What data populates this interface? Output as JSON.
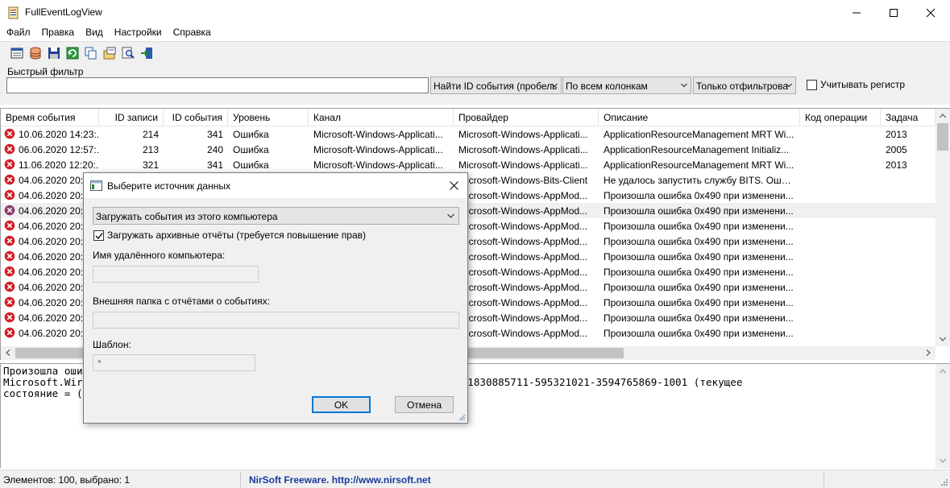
{
  "window": {
    "title": "FullEventLogView",
    "icon": "app-icon",
    "controls": [
      "minimize-icon",
      "maximize-icon",
      "close-icon"
    ]
  },
  "menu": [
    "Файл",
    "Правка",
    "Вид",
    "Настройки",
    "Справка"
  ],
  "toolbar": {
    "icons": [
      "properties-icon",
      "database-icon",
      "save-icon",
      "refresh-icon",
      "copy-icon",
      "export-html-icon",
      "find-icon",
      "exit-icon"
    ]
  },
  "filter": {
    "label": "Быстрый фильтр",
    "value": "",
    "combo1": "Найти ID события (пробель",
    "combo2": "По всем колонкам",
    "combo3": "Только отфильтрова",
    "case_label": "Учитывать регистр",
    "case_checked": false
  },
  "columns": [
    "Время события",
    "ID записи",
    "ID события",
    "Уровень",
    "Канал",
    "Провайдер",
    "Описание",
    "Код операции",
    "Задача"
  ],
  "rows": [
    {
      "time": "10.06.2020 14:23:...",
      "record": "214",
      "event": "341",
      "level": "Ошибка",
      "channel": "Microsoft-Windows-Applicati...",
      "provider": "Microsoft-Windows-Applicati...",
      "desc": "ApplicationResourceManagement MRT Wi...",
      "opcode": "",
      "task": "2013",
      "icon": "error-icon"
    },
    {
      "time": "06.06.2020 12:57:...",
      "record": "213",
      "event": "240",
      "level": "Ошибка",
      "channel": "Microsoft-Windows-Applicati...",
      "provider": "Microsoft-Windows-Applicati...",
      "desc": "ApplicationResourceManagement Initializ...",
      "opcode": "",
      "task": "2005",
      "icon": "error-icon"
    },
    {
      "time": "11.06.2020 12:20:...",
      "record": "321",
      "event": "341",
      "level": "Ошибка",
      "channel": "Microsoft-Windows-Applicati...",
      "provider": "Microsoft-Windows-Applicati...",
      "desc": "ApplicationResourceManagement MRT Wi...",
      "opcode": "",
      "task": "2013",
      "icon": "error-icon"
    },
    {
      "time": "04.06.2020 20:1",
      "record": "",
      "event": "",
      "level": "",
      "channel": "",
      "provider": "Microsoft-Windows-Bits-Client",
      "desc": "Не удалось запустить службу BITS. Ошиб...",
      "opcode": "",
      "task": "",
      "icon": "error-icon"
    },
    {
      "time": "04.06.2020 20:2",
      "record": "",
      "event": "",
      "level": "",
      "channel": "",
      "provider": "Microsoft-Windows-AppMod...",
      "desc": "Произошла ошибка 0x490 при изменени...",
      "opcode": "",
      "task": "",
      "icon": "error-icon"
    },
    {
      "time": "04.06.2020 20:2",
      "record": "",
      "event": "",
      "level": "",
      "channel": "",
      "provider": "Microsoft-Windows-AppMod...",
      "desc": "Произошла ошибка 0x490 при изменени...",
      "opcode": "",
      "task": "",
      "icon": "error-selected-icon",
      "selected": true
    },
    {
      "time": "04.06.2020 20:2",
      "record": "",
      "event": "",
      "level": "",
      "channel": "",
      "provider": "Microsoft-Windows-AppMod...",
      "desc": "Произошла ошибка 0x490 при изменени...",
      "opcode": "",
      "task": "",
      "icon": "error-icon"
    },
    {
      "time": "04.06.2020 20:2",
      "record": "",
      "event": "",
      "level": "",
      "channel": "",
      "provider": "Microsoft-Windows-AppMod...",
      "desc": "Произошла ошибка 0x490 при изменени...",
      "opcode": "",
      "task": "",
      "icon": "error-icon"
    },
    {
      "time": "04.06.2020 20:2",
      "record": "",
      "event": "",
      "level": "",
      "channel": "",
      "provider": "Microsoft-Windows-AppMod...",
      "desc": "Произошла ошибка 0x490 при изменени...",
      "opcode": "",
      "task": "",
      "icon": "error-icon"
    },
    {
      "time": "04.06.2020 20:2",
      "record": "",
      "event": "",
      "level": "",
      "channel": "",
      "provider": "Microsoft-Windows-AppMod...",
      "desc": "Произошла ошибка 0x490 при изменени...",
      "opcode": "",
      "task": "",
      "icon": "error-icon"
    },
    {
      "time": "04.06.2020 20:2",
      "record": "",
      "event": "",
      "level": "",
      "channel": "",
      "provider": "Microsoft-Windows-AppMod...",
      "desc": "Произошла ошибка 0x490 при изменени...",
      "opcode": "",
      "task": "",
      "icon": "error-icon"
    },
    {
      "time": "04.06.2020 20:2",
      "record": "",
      "event": "",
      "level": "",
      "channel": "",
      "provider": "Microsoft-Windows-AppMod...",
      "desc": "Произошла ошибка 0x490 при изменени...",
      "opcode": "",
      "task": "",
      "icon": "error-icon"
    },
    {
      "time": "04.06.2020 20:2",
      "record": "",
      "event": "",
      "level": "",
      "channel": "",
      "provider": "Microsoft-Windows-AppMod...",
      "desc": "Произошла ошибка 0x490 при изменени...",
      "opcode": "",
      "task": "",
      "icon": "error-icon"
    },
    {
      "time": "04.06.2020 20:2",
      "record": "",
      "event": "",
      "level": "",
      "channel": "",
      "provider": "Microsoft-Windows-AppMod...",
      "desc": "Произошла ошибка 0x490 при изменени...",
      "opcode": "",
      "task": "",
      "icon": "error-icon"
    }
  ],
  "detail_text": "Произошла оши                                          для пакета\nMicrosoft.Wir                                         пользователя S-1-5-21-1830885711-595321021-3594765869-1001 (текущее\nсостояние = (",
  "status": {
    "left": "Элементов: 100, выбрано: 1",
    "mid": "NirSoft Freeware.  http://www.nirsoft.net"
  },
  "dialog": {
    "title": "Выберите источник данных",
    "source": "Загружать события из этого компьютера",
    "archive_label": "Загружать архивные отчёты (требуется повышение прав)",
    "archive_checked": true,
    "remote_label": "Имя удалённого компьютера:",
    "remote_value": "",
    "folder_label": "Внешняя папка с отчётами о событиях:",
    "folder_value": "",
    "template_label": "Шаблон:",
    "template_value": "*",
    "ok": "OK",
    "cancel": "Отмена"
  }
}
